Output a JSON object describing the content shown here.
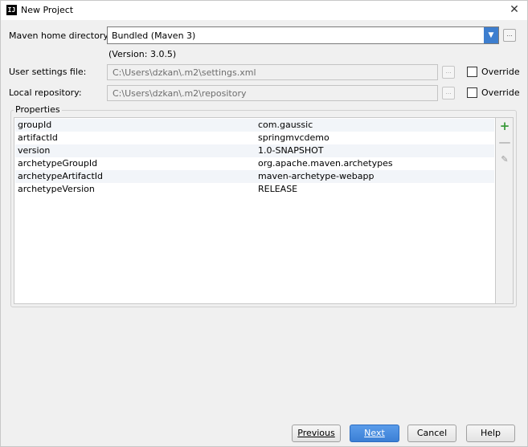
{
  "window": {
    "title": "New Project",
    "icon": "intellij-idea-icon",
    "close_glyph": "✕"
  },
  "maven_home": {
    "label": "Maven home directory:",
    "value": "Bundled (Maven 3)",
    "version_note": "(Version: 3.0.5)",
    "browse_label": "..."
  },
  "user_settings": {
    "label": "User settings file:",
    "value": "C:\\Users\\dzkan\\.m2\\settings.xml",
    "browse_label": "...",
    "override_label": "Override",
    "override_checked": false
  },
  "local_repo": {
    "label": "Local repository:",
    "value": "C:\\Users\\dzkan\\.m2\\repository",
    "browse_label": "...",
    "override_label": "Override",
    "override_checked": false
  },
  "properties": {
    "legend": "Properties",
    "rows": [
      {
        "key": "groupId",
        "value": "com.gaussic"
      },
      {
        "key": "artifactId",
        "value": "springmvcdemo"
      },
      {
        "key": "version",
        "value": "1.0-SNAPSHOT"
      },
      {
        "key": "archetypeGroupId",
        "value": "org.apache.maven.archetypes"
      },
      {
        "key": "archetypeArtifactId",
        "value": "maven-archetype-webapp"
      },
      {
        "key": "archetypeVersion",
        "value": "RELEASE"
      }
    ],
    "tools": {
      "add": "+",
      "remove": "—",
      "edit": "✎"
    }
  },
  "buttons": {
    "previous": "Previous",
    "next": "Next",
    "cancel": "Cancel",
    "help": "Help"
  },
  "colors": {
    "primary_button": "#3b7fd5",
    "combo_arrow": "#3d7ecf",
    "add_icon": "#3a9a3a"
  }
}
